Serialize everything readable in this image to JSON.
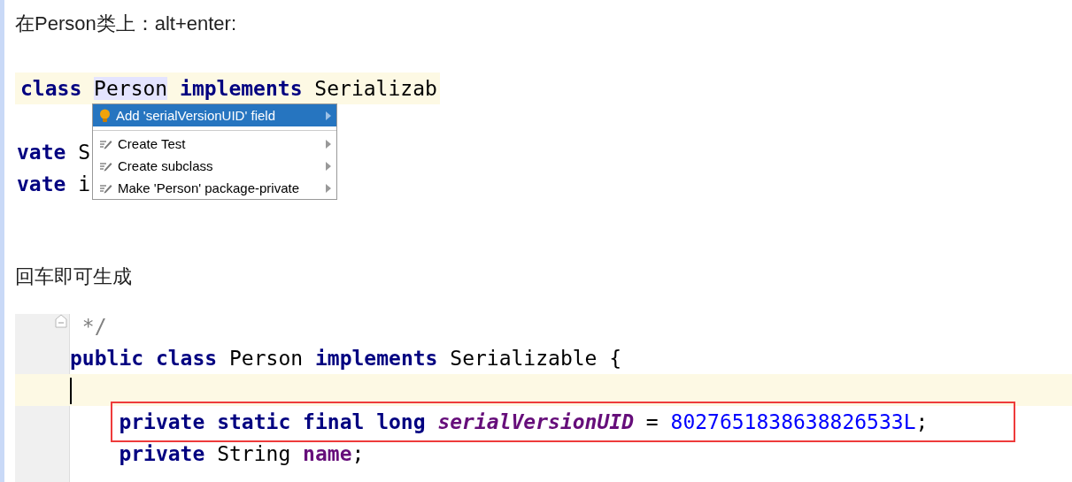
{
  "intro": {
    "text": "在Person类上：alt+enter:"
  },
  "snippet1": {
    "lines": [
      {
        "current": true,
        "tokens": [
          {
            "text": "class ",
            "kind": "keyword"
          },
          {
            "text": "Person",
            "kind": "usage"
          },
          {
            "text": " implements",
            "kind": "keyword"
          },
          {
            "text": " Serializab",
            "kind": "plain"
          }
        ]
      },
      {
        "current": false,
        "tokens": [
          {
            "text": "vate",
            "kind": "keyword"
          },
          {
            "text": " S",
            "kind": "plain"
          }
        ]
      },
      {
        "current": false,
        "tokens": [
          {
            "text": "vate",
            "kind": "keyword"
          },
          {
            "text": " i",
            "kind": "plain"
          }
        ]
      }
    ],
    "popup": {
      "groups": [
        [
          {
            "label": "Add 'serialVersionUID' field",
            "kind": "quickfix",
            "selected": true
          }
        ],
        [
          {
            "label": "Create Test",
            "kind": "intention",
            "selected": false
          },
          {
            "label": "Create subclass",
            "kind": "intention",
            "selected": false
          },
          {
            "label": "Make 'Person' package-private",
            "kind": "intention",
            "selected": false
          }
        ]
      ]
    }
  },
  "outro": {
    "text": "回车即可生成"
  },
  "snippet2": {
    "lines": [
      {
        "current": false,
        "fold": true,
        "tokens": [
          {
            "text": " */",
            "kind": "comment"
          }
        ]
      },
      {
        "current": false,
        "tokens": [
          {
            "text": "public class",
            "kind": "keyword"
          },
          {
            "text": " Person",
            "kind": "plain"
          },
          {
            "text": " implements",
            "kind": "keyword"
          },
          {
            "text": " Serializable {",
            "kind": "plain"
          }
        ]
      },
      {
        "current": true,
        "caret": true
      },
      {
        "current": false,
        "boxed": true,
        "tokens": [
          {
            "text": "    private static final long",
            "kind": "keyword"
          },
          {
            "text": " serialVersionUID",
            "kind": "static-field"
          },
          {
            "text": " = ",
            "kind": "plain"
          },
          {
            "text": "8027651838638826533L",
            "kind": "number"
          },
          {
            "text": ";",
            "kind": "plain"
          }
        ]
      },
      {
        "current": false,
        "tokens": [
          {
            "text": "    private",
            "kind": "keyword"
          },
          {
            "text": " String ",
            "kind": "plain"
          },
          {
            "text": "name",
            "kind": "field"
          },
          {
            "text": ";",
            "kind": "plain"
          }
        ]
      }
    ]
  }
}
